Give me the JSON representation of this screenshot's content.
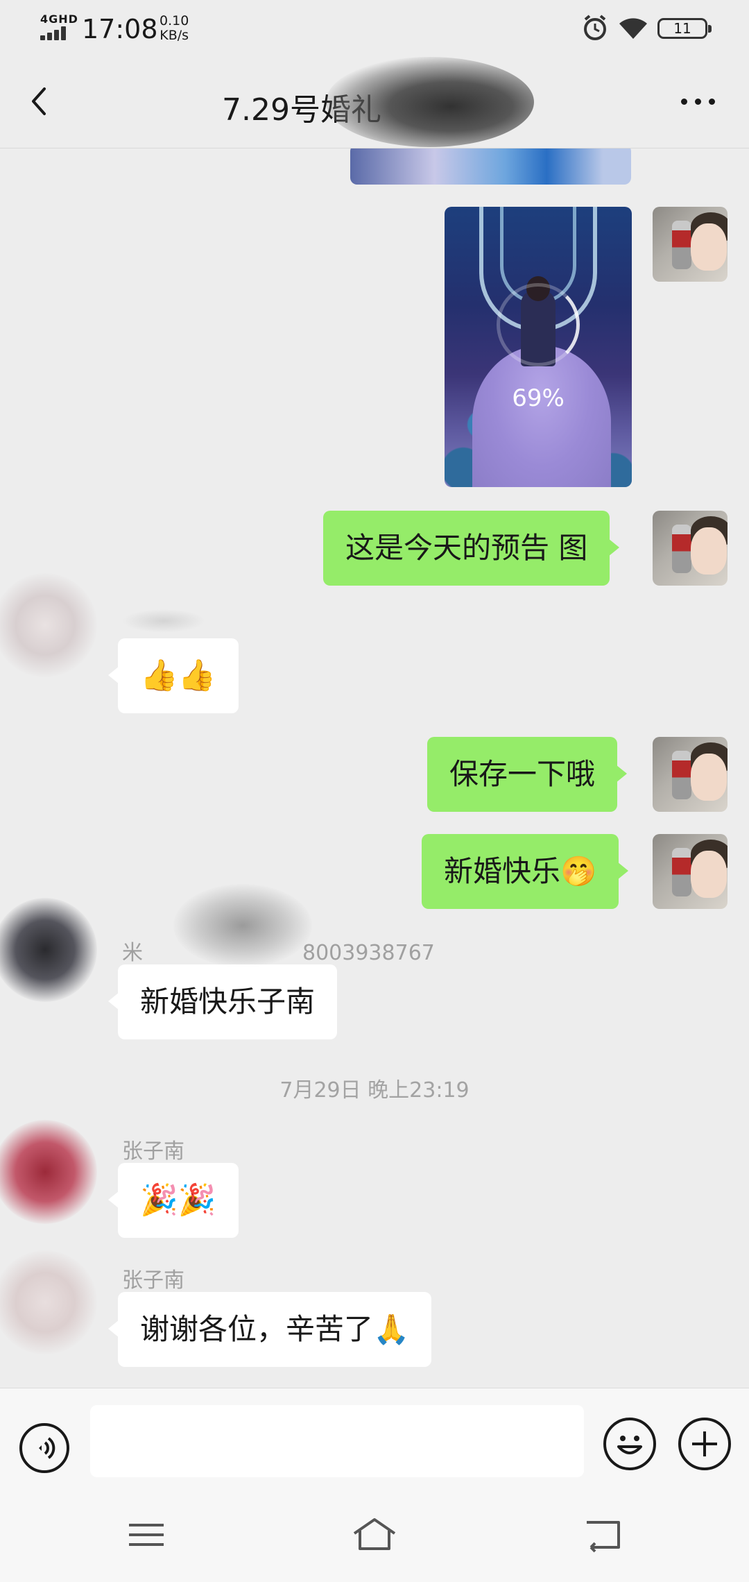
{
  "status_bar": {
    "network": "4GHD",
    "time": "17:08",
    "speed_value": "0.10",
    "speed_unit": "KB/s",
    "battery": "11"
  },
  "header": {
    "title": "7.29号婚礼"
  },
  "messages": {
    "image_progress": "69%",
    "me_preview": "这是今天的预告 图",
    "other_thumbs": "👍👍",
    "me_save": "保存一下哦",
    "me_congrats": "新婚快乐🤭",
    "sender_2_name": "米",
    "sender_2_phone": "8003938767",
    "other_congrats": "新婚快乐子南",
    "timestamp": "7月29日 晚上23:19",
    "sender_3_name": "张子南",
    "other_party": "🎉🎉",
    "sender_4_name": "张子南",
    "other_thanks": "谢谢各位，辛苦了🙏"
  },
  "input": {
    "placeholder": ""
  },
  "colors": {
    "chat_bg": "#ededed",
    "me_bubble": "#95ec69",
    "other_bubble": "#ffffff",
    "meta_text": "#a3a3a3"
  }
}
